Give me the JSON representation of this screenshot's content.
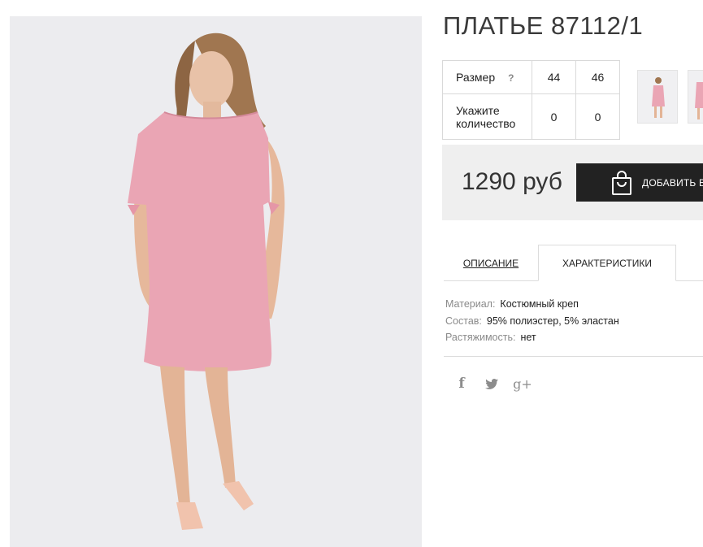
{
  "product": {
    "title": "ПЛАТЬЕ 87112/1",
    "photo_icon": "dress-model-photo",
    "thumbnails": [
      "thumbnail-1",
      "thumbnail-2"
    ]
  },
  "sizes": {
    "size_label": "Размер",
    "help_mark": "?",
    "size_values": [
      "44",
      "46"
    ],
    "qty_label": "Укажите количество",
    "qty_values": [
      "0",
      "0"
    ]
  },
  "purchase": {
    "price": "1290 руб",
    "add_button_label": "ДОБАВИТЬ В",
    "add_icon": "shopping-bag-icon"
  },
  "tabs": [
    {
      "label": "ОПИСАНИЕ",
      "active": false
    },
    {
      "label": "ХАРАКТЕРИСТИКИ",
      "active": true
    }
  ],
  "characteristics": [
    {
      "key": "Материал:",
      "value": "Костюмный креп"
    },
    {
      "key": "Состав:",
      "value": "95% полиэстер, 5% эластан"
    },
    {
      "key": "Растяжимость:",
      "value": "нет"
    }
  ],
  "social": {
    "facebook": "f",
    "twitter_icon": "twitter-icon",
    "googleplus": "g+"
  },
  "colors": {
    "photo_bg": "#ececef",
    "dress_pink": "#eaa5b4",
    "button_dark": "#222222",
    "buybar_bg": "#efefef"
  }
}
